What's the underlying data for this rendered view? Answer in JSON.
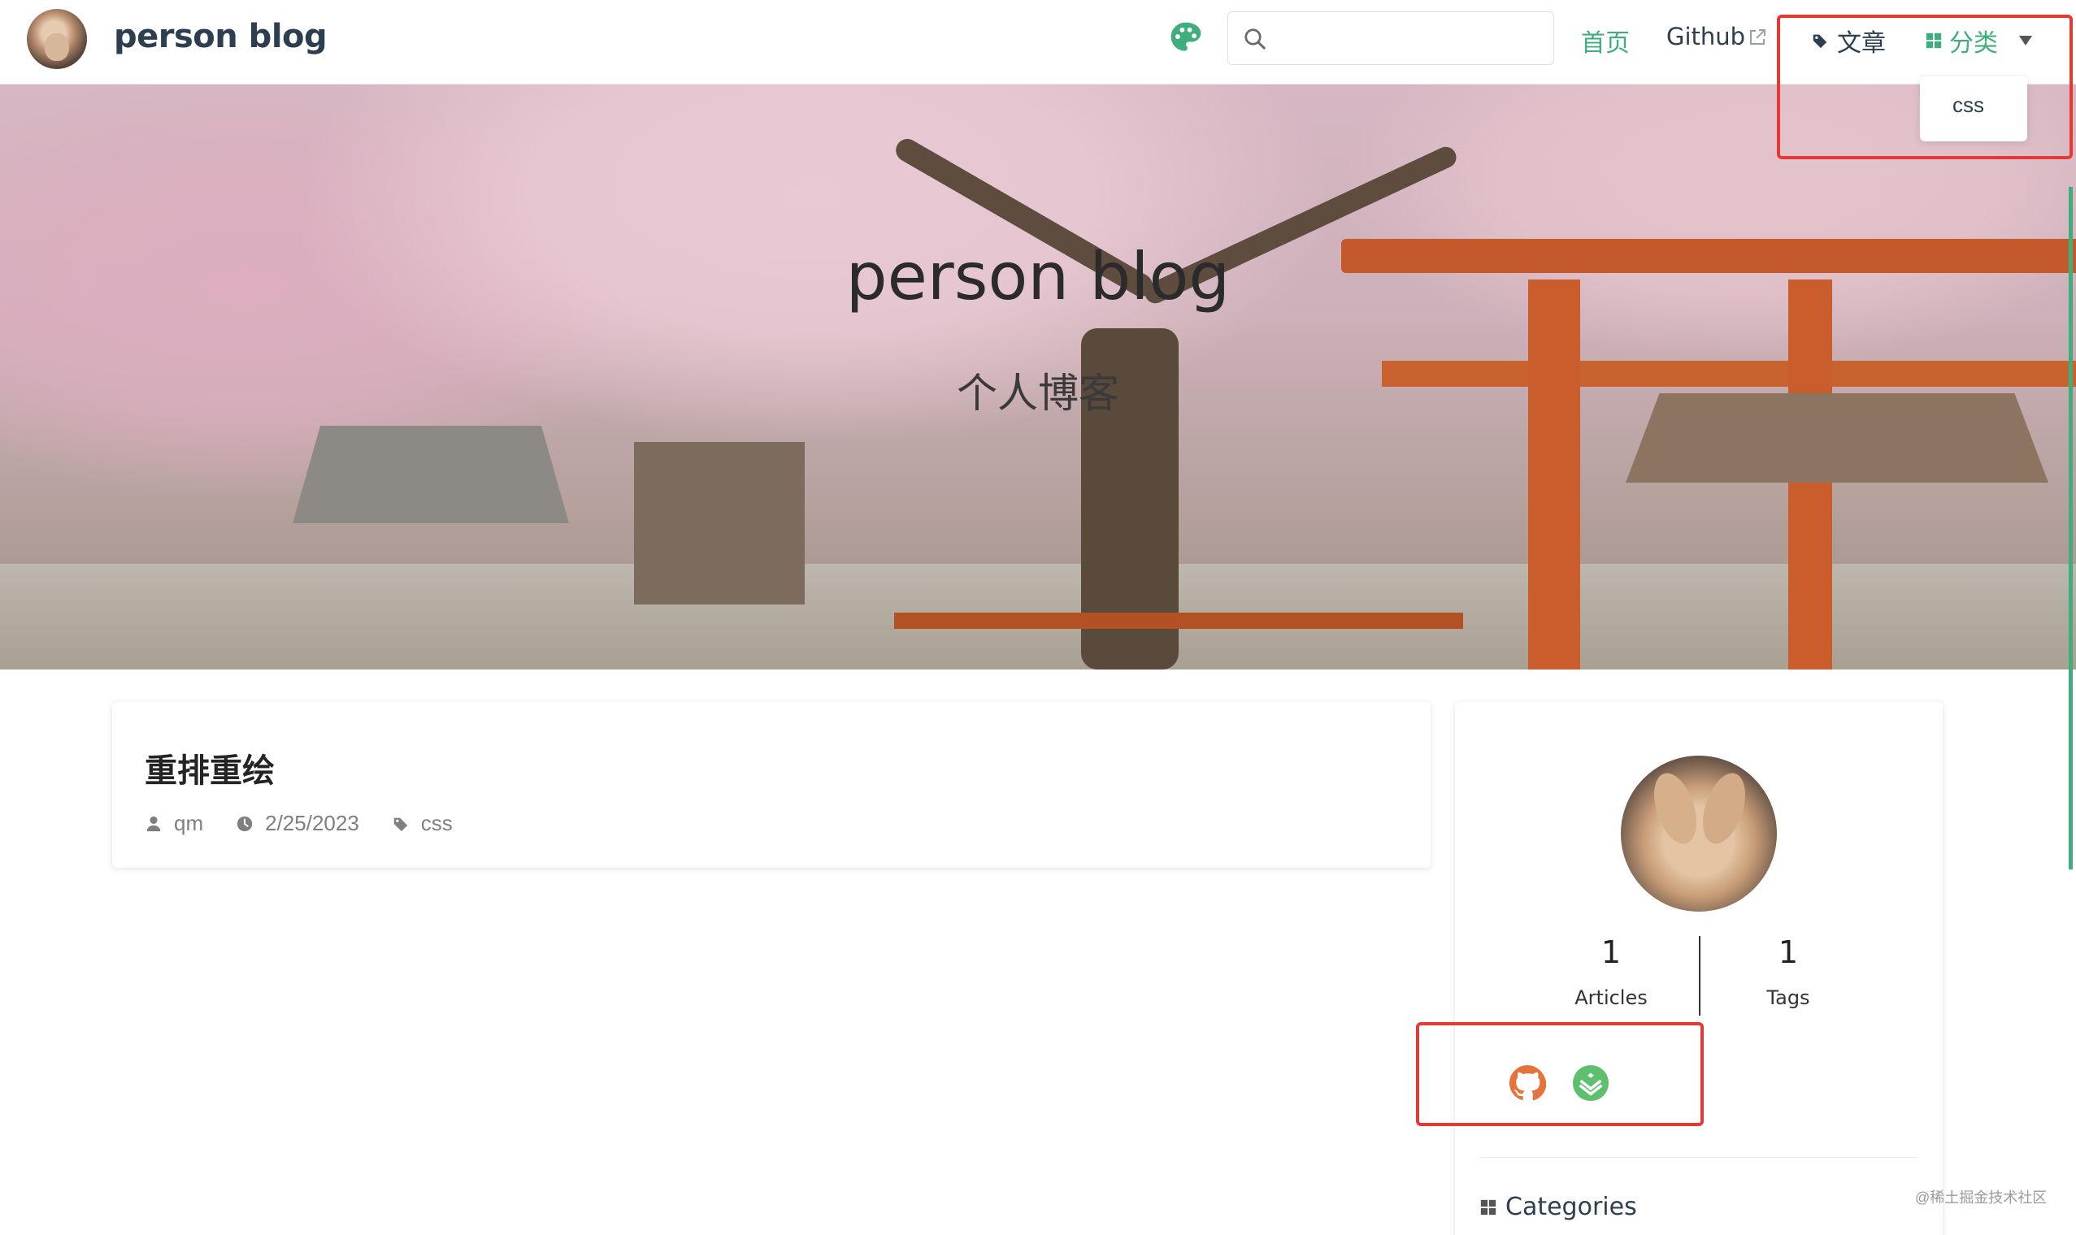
{
  "navbar": {
    "site_name": "person blog",
    "search": {
      "value": "",
      "placeholder": ""
    },
    "links": {
      "home": "首页",
      "github": "Github",
      "articles": "文章",
      "categories": "分类"
    },
    "dropdown_items": [
      "css"
    ],
    "accent_color": "#3eaf7c"
  },
  "hero": {
    "title": "person blog",
    "subtitle": "个人博客"
  },
  "post": {
    "title": "重排重绘",
    "author": "qm",
    "date": "2/25/2023",
    "tag": "css"
  },
  "sidebar": {
    "articles_count": "1",
    "articles_label": "Articles",
    "tags_count": "1",
    "tags_label": "Tags",
    "social": [
      "github-icon",
      "juejin-icon"
    ],
    "categories_heading": "Categories"
  },
  "watermark": "@稀土掘金技术社区",
  "colors": {
    "highlight_border": "#e53935",
    "github_icon": "#e4733c",
    "juejin_icon": "#5cc06f"
  }
}
